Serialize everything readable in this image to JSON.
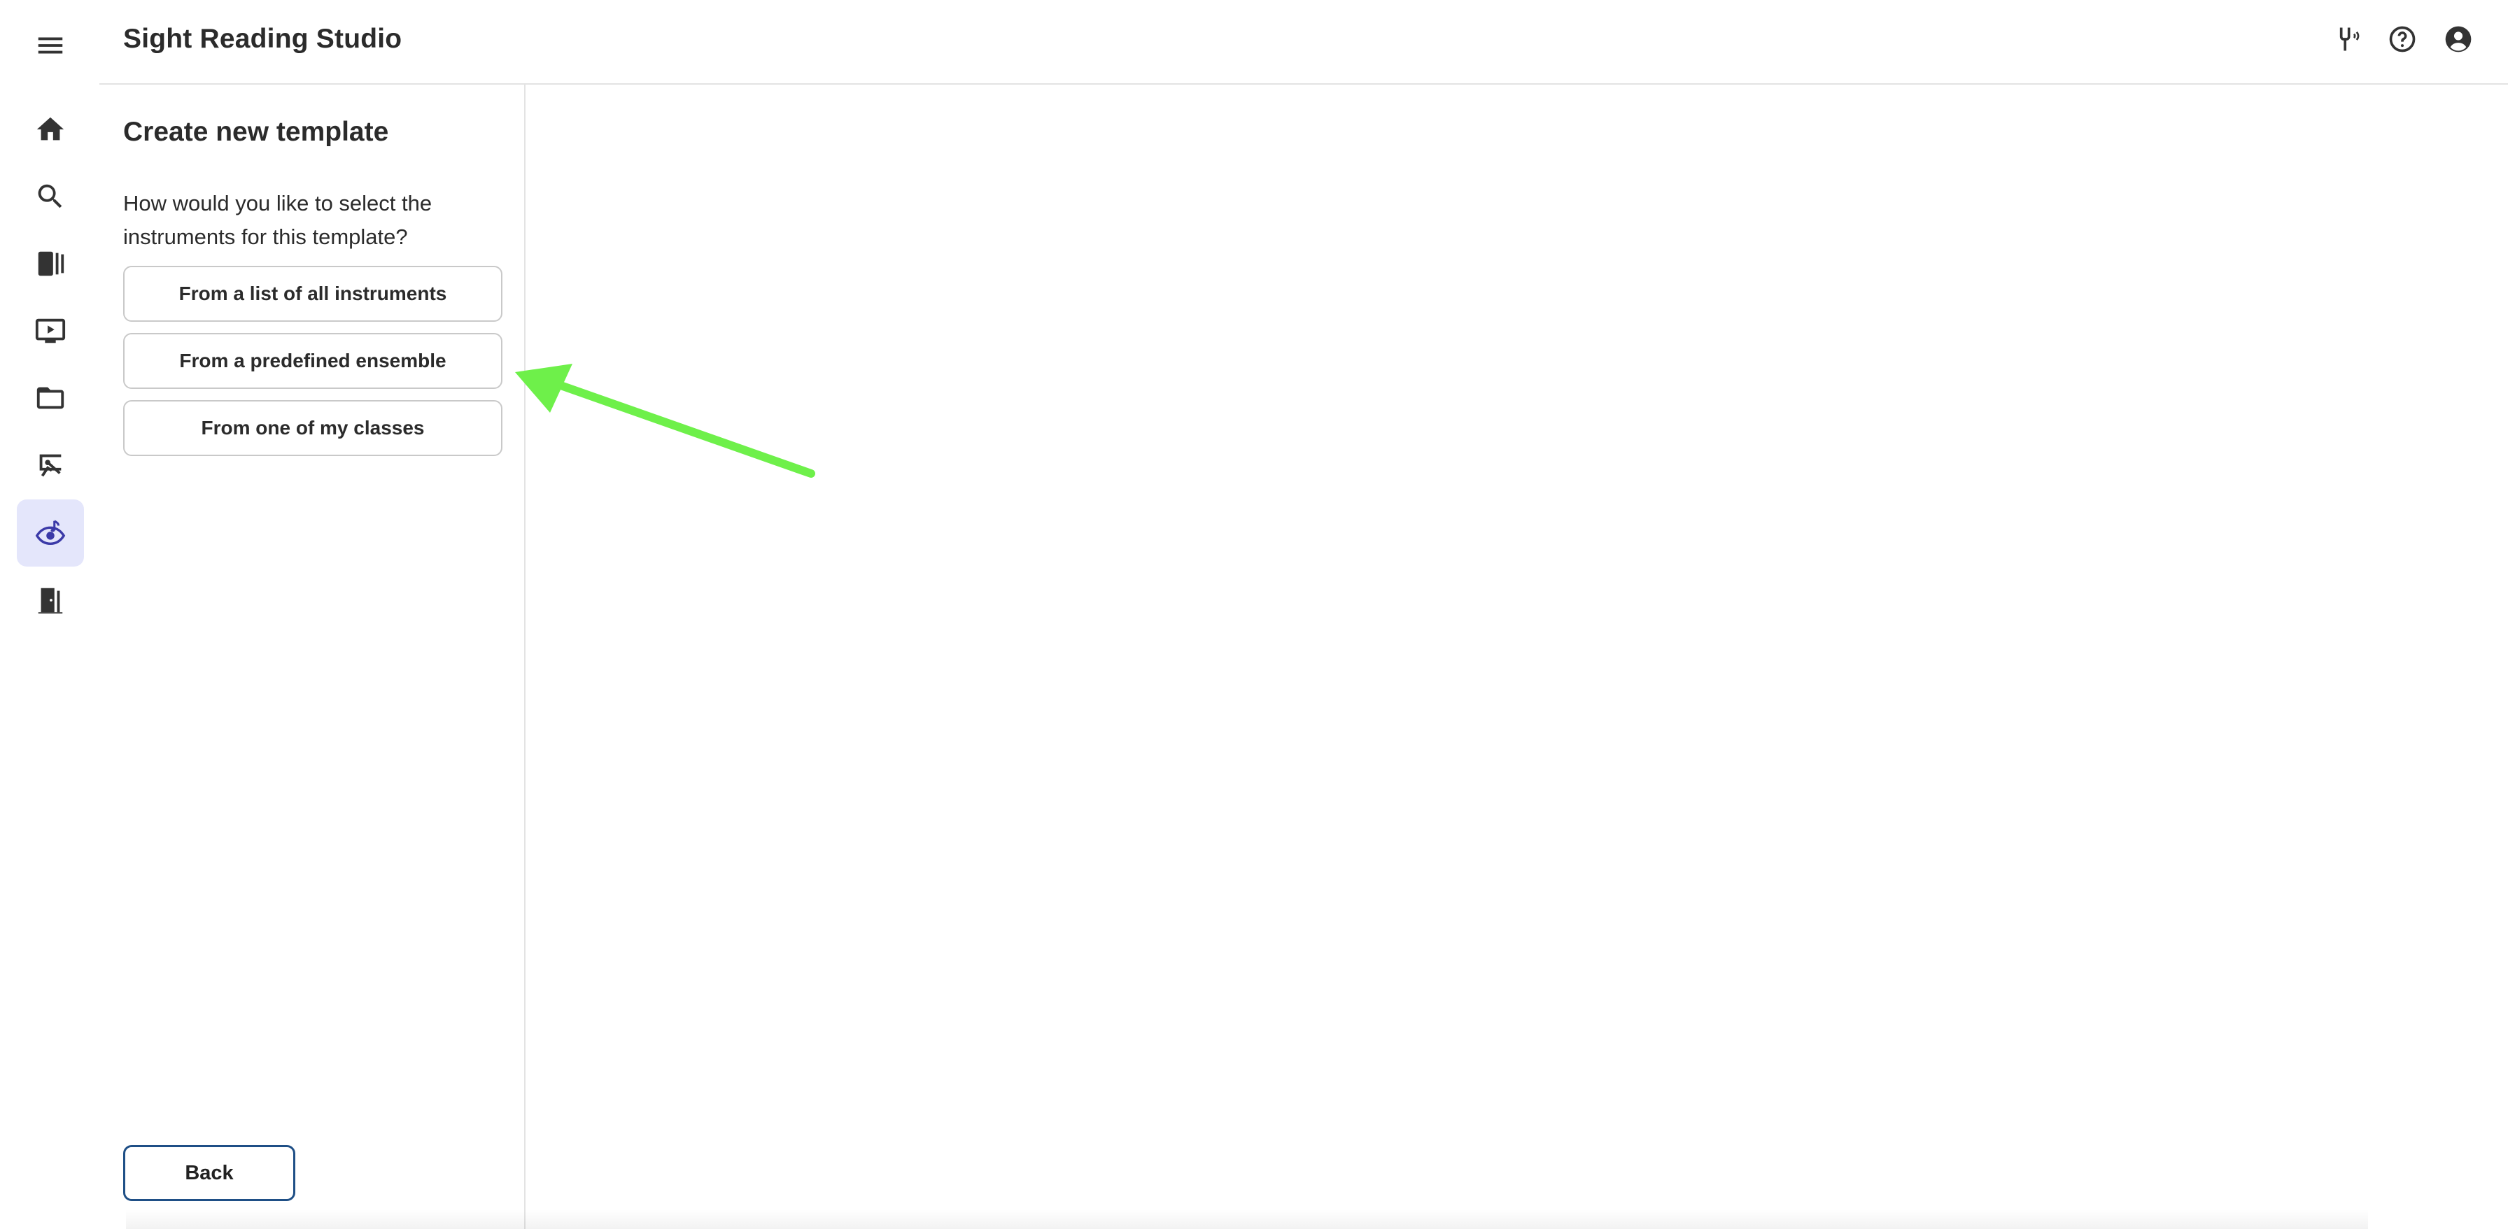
{
  "app": {
    "title": "Sight Reading Studio"
  },
  "rail": {
    "items": [
      {
        "name": "menu",
        "icon": "menu-icon"
      },
      {
        "name": "home",
        "icon": "home-icon"
      },
      {
        "name": "search",
        "icon": "search-icon"
      },
      {
        "name": "library",
        "icon": "library-icon"
      },
      {
        "name": "video",
        "icon": "video-icon"
      },
      {
        "name": "folder",
        "icon": "folder-icon"
      },
      {
        "name": "teaching",
        "icon": "teacher-icon"
      },
      {
        "name": "sight-reading",
        "icon": "eye-music-icon",
        "active": true
      },
      {
        "name": "exit",
        "icon": "door-exit-icon"
      }
    ],
    "active_color": "#e4e6fb",
    "active_icon_color": "#3b3aa8"
  },
  "header": {
    "icons": [
      "tuning-fork-icon",
      "help-icon",
      "account-icon"
    ]
  },
  "panel": {
    "title": "Create new template",
    "question": "How would you like to select the instruments for this template?",
    "choices": [
      {
        "label": "From a list of all instruments"
      },
      {
        "label": "From a predefined ensemble"
      },
      {
        "label": "From one of my classes"
      }
    ],
    "back_label": "Back"
  },
  "annotation": {
    "arrow_color": "#6ef04a"
  }
}
